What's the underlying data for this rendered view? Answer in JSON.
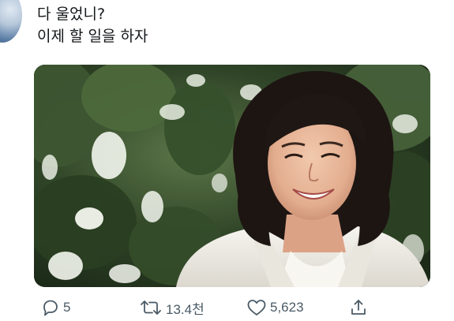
{
  "tweet": {
    "lines": [
      "다 울었니?",
      "이제 할 일을 하자"
    ]
  },
  "media": {
    "description_icon": "photo-image"
  },
  "actions": {
    "reply": {
      "icon": "reply-icon",
      "count": "5"
    },
    "retweet": {
      "icon": "retweet-icon",
      "count": "13.4천"
    },
    "like": {
      "icon": "heart-icon",
      "count": "5,623"
    },
    "share": {
      "icon": "share-icon"
    }
  },
  "colors": {
    "text": "#14171a",
    "icon": "#4a5a66",
    "background": "#ffffff"
  }
}
